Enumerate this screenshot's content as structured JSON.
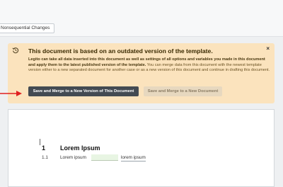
{
  "header": {
    "tab_label": "Nonsequential Changes"
  },
  "banner": {
    "title": "This document is based on an outdated version of the template.",
    "close_label": "×",
    "body_bold": "Legito can take all data inserted into this document as well as settings of all options and variables you made in this document and apply them to the latest published version of the template.",
    "body_rest": " You can merge data from this document with the newest template version either to a new separated document for another case or as a new version of this document and continue in drafting this document.",
    "primary_button": "Save and Merge to a New Version of This Document",
    "secondary_button": "Save and Merge to a New Document",
    "colors": {
      "background": "#fbe3bd",
      "primary_button": "#434a52",
      "arrow": "#e02020"
    }
  },
  "document": {
    "heading_number": "1",
    "heading_title": "Lorem Ipsum",
    "row_number": "1.1",
    "row_text_before": "Lorem ipsum",
    "row_text_after": "lorem ipsum"
  }
}
